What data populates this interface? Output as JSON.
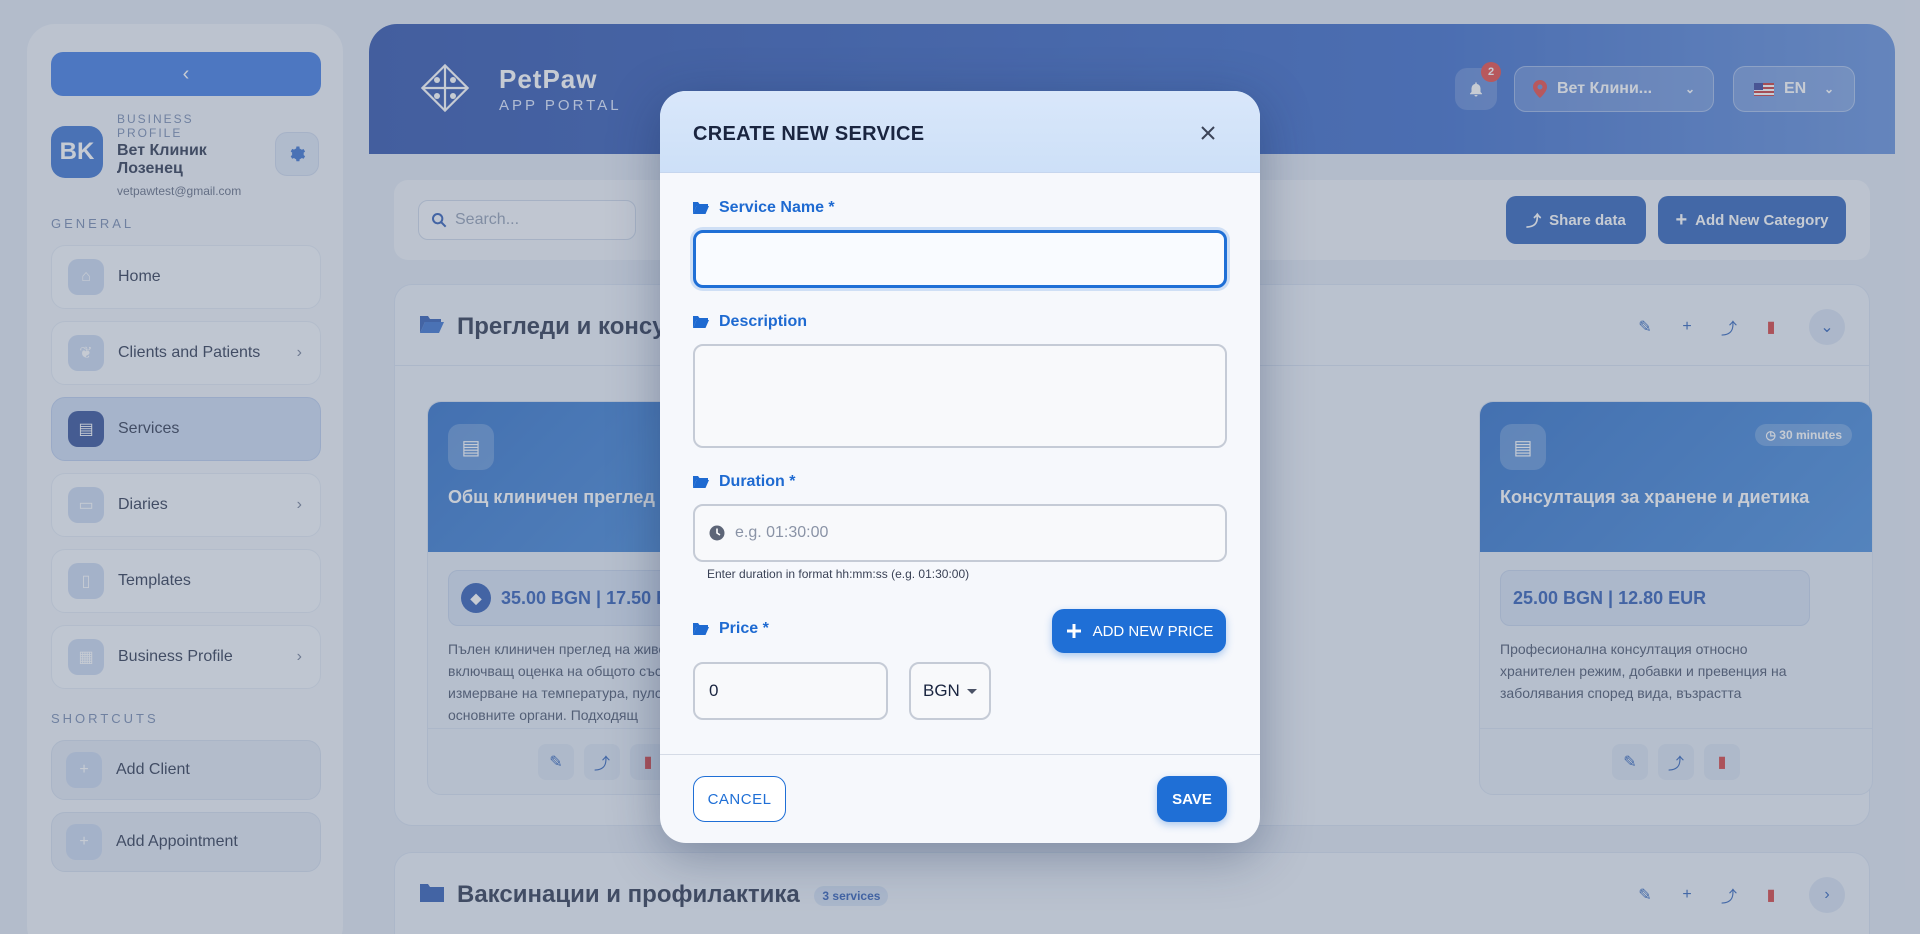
{
  "sidebar": {
    "collapse_glyph": "‹",
    "profile": {
      "initials": "BK",
      "caption": "BUSINESS PROFILE",
      "name": "Вет Клиник Лозенец",
      "email": "vetpawtest@gmail.com"
    },
    "general_label": "GENERAL",
    "items": [
      {
        "label": "Home",
        "icon": "home-icon"
      },
      {
        "label": "Clients and Patients",
        "icon": "paw-icon"
      },
      {
        "label": "Services",
        "icon": "clipboard-icon"
      },
      {
        "label": "Diaries",
        "icon": "book-icon"
      },
      {
        "label": "Templates",
        "icon": "document-icon"
      },
      {
        "label": "Business Profile",
        "icon": "business-icon"
      }
    ],
    "shortcuts_label": "SHORTCUTS",
    "shortcuts": [
      {
        "label": "Add Client",
        "icon": "add-user-icon"
      },
      {
        "label": "Add Appointment",
        "icon": "calendar-plus-icon"
      }
    ]
  },
  "header": {
    "brand_name": "PetPaw",
    "brand_sub": "APP PORTAL",
    "notification_count": "2",
    "location": "Вет Клини...",
    "language": "EN"
  },
  "toolbar": {
    "search_placeholder": "Search...",
    "share_data_label": "Share data",
    "add_category_label": "Add New Category"
  },
  "categories": [
    {
      "title": "Прегледи и консултации",
      "services": [
        {
          "title": "Общ клиничен преглед",
          "price": "35.00 BGN | 17.50 EUR",
          "description": "Пълен клиничен преглед на животното, включващ оценка на общото състояние, измерване на температура, пулс и преглед на основните органи. Подходящ"
        },
        {
          "title": "Консултация за хранене и диетика",
          "duration": "30 minutes",
          "price": "25.00 BGN | 12.80 EUR",
          "description": "Професионална консултация относно хранителен режим, добавки и превенция на заболявания според вида, възрастта"
        }
      ]
    },
    {
      "title": "Ваксинации и профилактика",
      "count": "3 services"
    }
  ],
  "modal": {
    "title": "CREATE NEW SERVICE",
    "service_name_label": "Service Name *",
    "service_name_value": "",
    "description_label": "Description",
    "description_value": "",
    "duration_label": "Duration *",
    "duration_placeholder": "e.g. 01:30:00",
    "duration_helper": "Enter duration in format hh:mm:ss (e.g. 01:30:00)",
    "price_label": "Price *",
    "add_price_label": "ADD NEW PRICE",
    "price_value": "0",
    "currency": "BGN",
    "cancel_label": "CANCEL",
    "save_label": "SAVE"
  },
  "colors": {
    "primary": "#1f6fd6",
    "header_blue": "#1e44a4",
    "danger": "#d32f2f"
  }
}
